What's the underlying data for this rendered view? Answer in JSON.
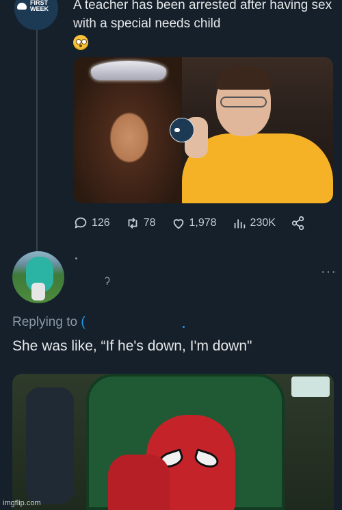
{
  "tweet": {
    "avatar_brand": "FIRST\nWEEK",
    "avatar_brand_line1": "FIRST",
    "avatar_brand_line2": "WEEK",
    "text": "A teacher has been arrested after having sex with a special needs child",
    "emoji": "flushed-face",
    "media_badge": "FIRST WEEK",
    "actions": {
      "replies": "126",
      "retweets": "78",
      "likes": "1,978",
      "views": "230K"
    }
  },
  "reply": {
    "replying_to_label": "Replying to",
    "replying_to_handle": "(",
    "text": "She was like, “If he's down, I'm down\"",
    "more": "···"
  },
  "watermark": "imgflip.com",
  "colors": {
    "background": "#15202b",
    "text": "#e7e9ea",
    "muted": "#8b98a5",
    "accent": "#1d9bf0"
  }
}
